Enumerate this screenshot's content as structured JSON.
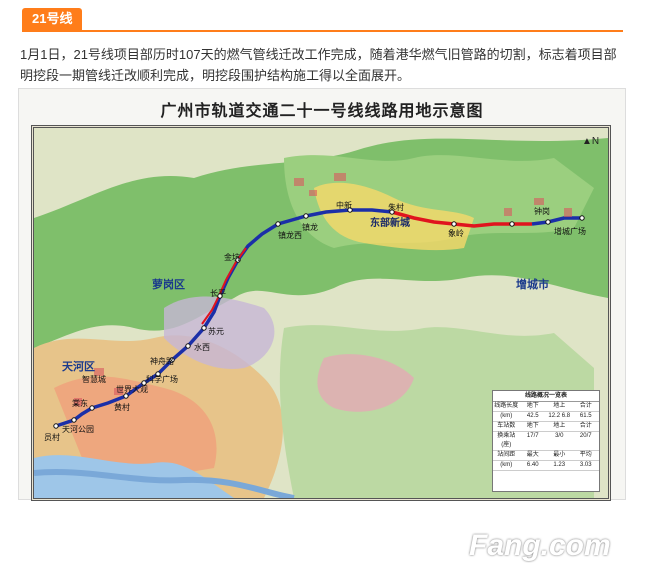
{
  "tab": {
    "label": "21号线"
  },
  "article": {
    "text": "1月1日，21号线项目部历时107天的燃气管线迁改工作完成，随着港华燃气旧管路的切割，标志着项目部明挖段一期管线迁改顺利完成，明挖段围护结构施工得以全面展开。"
  },
  "map": {
    "title": "广州市轨道交通二十一号线线路用地示意图",
    "districts": [
      "萝岗区",
      "天河区",
      "东部新城",
      "增城市"
    ],
    "stations": [
      "员村",
      "天河公园",
      "棠东",
      "黄村",
      "智慧城",
      "世界大观",
      "科学广场",
      "神舟路",
      "水西",
      "苏元",
      "长平",
      "金坑",
      "镇龙西",
      "镇龙",
      "中新",
      "朱村",
      "象岭",
      "钟岗",
      "增城广场"
    ],
    "legend": {
      "title": "线路概况一览表",
      "rows": [
        [
          "线路长度",
          "地下",
          "地上",
          "合计"
        ],
        [
          "(km)",
          "42.5",
          "12.2  6.8",
          "61.5"
        ],
        [
          "车站数",
          "地下",
          "地上",
          "合计"
        ],
        [
          "换乘站(座)",
          "17/7",
          "3/0",
          "20/7"
        ],
        [
          "站间距",
          "最大",
          "最小",
          "平均"
        ],
        [
          "(km)",
          "6.40",
          "1.23",
          "3.03"
        ]
      ]
    }
  },
  "watermark": {
    "text": "Fang.com"
  },
  "colors": {
    "accent": "#ff7d1a",
    "line_blue": "#1b2fa8",
    "line_red": "#e0141e"
  }
}
